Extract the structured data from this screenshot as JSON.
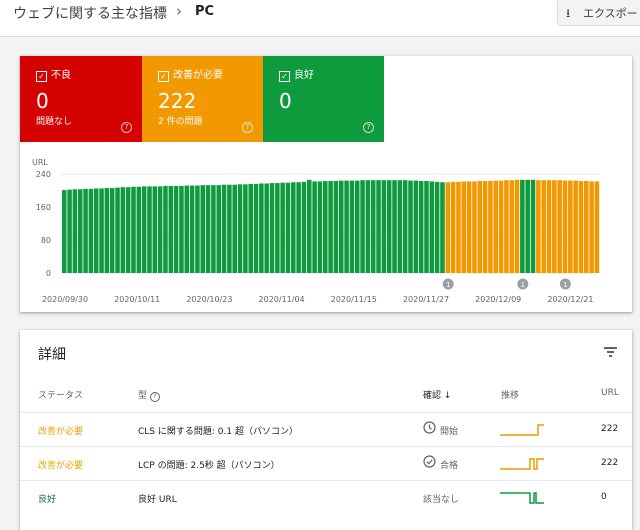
{
  "header": {
    "title": "ウェブに関する主な指標",
    "separator": "›",
    "subtitle": "PC",
    "export_label": "エクスポート",
    "export_icon": "download-icon"
  },
  "summary": {
    "poor": {
      "label": "不良",
      "value": "0",
      "sub": "問題なし",
      "color": "#d50000"
    },
    "needs_improvement": {
      "label": "改善が必要",
      "value": "222",
      "sub": "2 件の問題",
      "color": "#f29900"
    },
    "good": {
      "label": "良好",
      "value": "0",
      "sub": "",
      "color": "#0d9b3d"
    }
  },
  "chart_data": {
    "type": "bar",
    "ylabel": "URL",
    "yticks": [
      "240",
      "160",
      "80",
      "0"
    ],
    "ylim": [
      0,
      240
    ],
    "x_ticks": [
      "2020/09/30",
      "2020/10/11",
      "2020/10/23",
      "2020/11/04",
      "2020/11/15",
      "2020/11/27",
      "2020/12/09",
      "2020/12/21"
    ],
    "series": [
      {
        "name": "良好",
        "color": "#0d9b3d",
        "values": [
          201,
          202,
          203,
          203,
          204,
          204,
          205,
          205,
          206,
          206,
          207,
          208,
          208,
          209,
          209,
          210,
          210,
          210,
          210,
          211,
          211,
          211,
          211,
          212,
          212,
          212,
          213,
          213,
          213,
          213,
          214,
          214,
          214,
          215,
          215,
          216,
          216,
          217,
          217,
          218,
          218,
          219,
          219,
          220,
          220,
          221,
          226,
          222,
          222,
          223,
          223,
          223,
          224,
          224,
          224,
          224,
          225,
          225,
          225,
          225,
          225,
          225,
          225,
          225,
          225,
          224,
          224,
          223,
          223,
          222,
          221,
          220,
          0,
          0,
          0,
          0,
          0,
          0,
          0,
          0,
          0,
          0,
          0,
          0,
          0,
          0,
          226,
          226,
          226,
          0,
          0,
          0,
          0,
          0,
          0,
          0,
          0,
          0,
          0,
          0,
          0
        ]
      },
      {
        "name": "改善が必要",
        "color": "#f29900",
        "values": [
          0,
          0,
          0,
          0,
          0,
          0,
          0,
          0,
          0,
          0,
          0,
          0,
          0,
          0,
          0,
          0,
          0,
          0,
          0,
          0,
          0,
          0,
          0,
          0,
          0,
          0,
          0,
          0,
          0,
          0,
          0,
          0,
          0,
          0,
          0,
          0,
          0,
          0,
          0,
          0,
          0,
          0,
          0,
          0,
          0,
          0,
          0,
          0,
          0,
          0,
          0,
          0,
          0,
          0,
          0,
          0,
          0,
          0,
          0,
          0,
          0,
          0,
          0,
          0,
          0,
          0,
          0,
          0,
          0,
          0,
          0,
          0,
          220,
          221,
          221,
          222,
          222,
          222,
          223,
          223,
          223,
          224,
          224,
          225,
          225,
          226,
          0,
          0,
          0,
          225,
          225,
          225,
          225,
          225,
          224,
          224,
          224,
          223,
          223,
          222,
          222
        ]
      }
    ],
    "annotations": [
      "1",
      "1",
      "1"
    ]
  },
  "details": {
    "title": "詳細",
    "columns": {
      "status": "ステータス",
      "type": "型",
      "validation": "確認",
      "trend": "推移",
      "urls": "URL"
    },
    "rows": [
      {
        "status": "改善が必要",
        "type": "CLS に関する問題: 0.1 超（パソコン）",
        "validation": "開始",
        "urls": "222",
        "status_class": "need",
        "icon": "clock-icon"
      },
      {
        "status": "改善が必要",
        "type": "LCP の問題: 2.5秒 超（パソコン）",
        "validation": "合格",
        "urls": "222",
        "status_class": "need",
        "icon": "check-circle-icon"
      },
      {
        "status": "良好",
        "type": "良好 URL",
        "validation": "該当なし",
        "urls": "0",
        "status_class": "good",
        "icon": ""
      }
    ]
  }
}
